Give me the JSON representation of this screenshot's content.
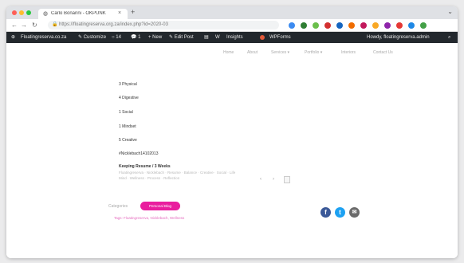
{
  "browser": {
    "tab_title": "Carlo Bonanni - OKPUNK",
    "tab_close": "×",
    "new_tab": "+",
    "menu": "⌄",
    "url": "https://floatingreserva.org.za/index.php?id=2020-03",
    "nav": {
      "back": "←",
      "forward": "→",
      "reload": "↻"
    },
    "lock": "🔒"
  },
  "extensions": [
    {
      "color": "#3c8bf0"
    },
    {
      "color": "#2e7d32"
    },
    {
      "color": "#6abf4b"
    },
    {
      "color": "#d32f2f"
    },
    {
      "color": "#1565c0"
    },
    {
      "color": "#ef6c00"
    },
    {
      "color": "#c2185b"
    },
    {
      "color": "#f9a825"
    },
    {
      "color": "#8e24aa"
    },
    {
      "color": "#e53935"
    },
    {
      "color": "#1e88e5"
    },
    {
      "color": "#43a047"
    }
  ],
  "wp_admin_bar": {
    "items": [
      "⊕",
      "Floatingreserva.co.za",
      "✎ Customize",
      "○ 14",
      "💬 1",
      "+ New",
      "✎ Edit Post",
      "▤",
      "W",
      "Insights",
      "WPForms"
    ],
    "greeting": "Howdy, floatingreserva.admin",
    "search_icon": "⌕"
  },
  "site_nav": {
    "links": [
      "Home",
      "About",
      "Services ▾",
      "Portfolio ▾",
      "Interiors",
      "Contact Us"
    ]
  },
  "post": {
    "lines": [
      "3 Physical",
      "4 Digestive",
      "1 Social",
      "1 Mindset",
      "5 Creative",
      "#Nicklebach14102013",
      "Keeping Resume / 3 Weeks"
    ],
    "tag_lines": [
      "Floatingreserva · Nicklebach · Resume · Balance · Creative · Social · Life",
      "Mind · Wellness · Process · Reflection"
    ],
    "pager_prev": "‹",
    "pager_next": "›",
    "category_label": "Categories",
    "category": "Personal Blog",
    "tags_line": "Tags: Floatingreserva, Nicklebach, Wellness"
  },
  "share": {
    "facebook": "f",
    "twitter": "t",
    "email": "✉"
  },
  "colors": {
    "accent": "#e91e9e",
    "admin_bar": "#23282d"
  }
}
